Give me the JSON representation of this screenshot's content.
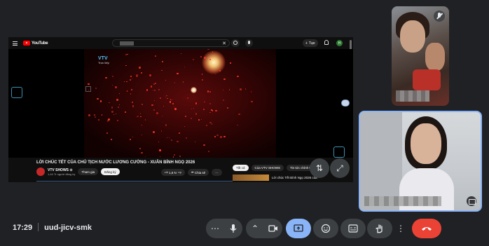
{
  "youtube": {
    "logo_text": "YouTube",
    "create_label": "Tạo",
    "avatar_letter": "H",
    "channel_logo_text": "VTV",
    "channel_logo_sub": "Trực tiếp",
    "video_title": "LỜI CHÚC TẾT CỦA CHỦ TỊCH NƯỚC LƯƠNG CƯỜNG - XUÂN BÍNH NGỌ 2026",
    "channel_name": "VTV SHOWS ⊙",
    "channel_subs": "1,44 Tr người đăng ký",
    "join_label": "Tham gia",
    "subscribe_label": "Đăng ký",
    "like_count": "1,6 N",
    "share_label": "Chia sẻ",
    "more_label": "···",
    "chips": [
      "Tất cả",
      "Của VTV SHOWS",
      "Tin tức chính trị"
    ],
    "recommended_title": "Lời chúc Tết Bính Ngọ 2026 của"
  },
  "meeting": {
    "time": "17:29",
    "code": "uud-jicv-smk"
  },
  "controls": {
    "more_options_left": "⋯",
    "mic": "mic-icon",
    "present_arrow": "⌃",
    "camera": "camera-icon",
    "share_screen": "present-icon",
    "emoji": "emoji-icon",
    "captions": "captions-icon",
    "raise_hand": "hand-icon",
    "more": "⋮",
    "end_call": "end-call-icon"
  },
  "colors": {
    "background": "#202124",
    "active_control": "#8ab4f8",
    "end_call": "#ea4335",
    "youtube_red": "#ff0000"
  }
}
